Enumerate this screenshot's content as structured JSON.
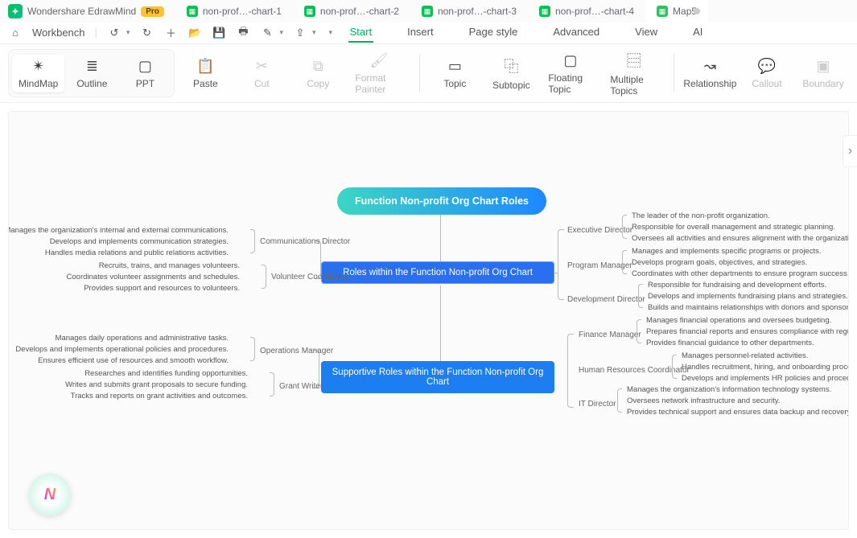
{
  "app": {
    "name": "Wondershare EdrawMind",
    "badge": "Pro",
    "logo_glyph": "✦"
  },
  "tabs": [
    {
      "label": "non-prof…-chart-1"
    },
    {
      "label": "non-prof…-chart-2"
    },
    {
      "label": "non-prof…-chart-3"
    },
    {
      "label": "non-prof…-chart-4"
    },
    {
      "label": "Map5",
      "active": true,
      "dirty": true
    }
  ],
  "toolbar": {
    "workbench": "Workbench"
  },
  "menu": {
    "start": "Start",
    "insert": "Insert",
    "page_style": "Page style",
    "advanced": "Advanced",
    "view": "View",
    "ai": "AI"
  },
  "ribbon": {
    "mindmap": "MindMap",
    "outline": "Outline",
    "ppt": "PPT",
    "paste": "Paste",
    "cut": "Cut",
    "copy": "Copy",
    "format_painter": "Format Painter",
    "topic": "Topic",
    "subtopic": "Subtopic",
    "floating": "Floating Topic",
    "multiple": "Multiple Topics",
    "relationship": "Relationship",
    "callout": "Callout",
    "boundary": "Boundary"
  },
  "mindmap": {
    "root": "Function Non-profit Org Chart Roles",
    "sec1": "Roles within the Function Non-profit Org Chart",
    "sec2": "Supportive Roles within the Function Non-profit Org Chart",
    "right1": {
      "exec": {
        "label": "Executive Director",
        "items": [
          "The leader of the non-profit organization.",
          "Responsible for overall management and strategic planning.",
          "Oversees all activities and ensures alignment with the organization's mission."
        ]
      },
      "prog": {
        "label": "Program Manager",
        "items": [
          "Manages and implements specific programs or projects.",
          "Develops program goals, objectives, and strategies.",
          "Coordinates with other departments to ensure program success."
        ]
      },
      "dev": {
        "label": "Development Director",
        "items": [
          "Responsible for fundraising and development efforts.",
          "Develops and implements fundraising plans and strategies.",
          "Builds and maintains relationships with donors and sponsors."
        ]
      }
    },
    "left1": {
      "comm": {
        "label": "Communications Director",
        "items": [
          "Manages the organization's internal and external communications.",
          "Develops and implements communication strategies.",
          "Handles media relations and public relations activities."
        ]
      },
      "vol": {
        "label": "Volunteer Coordinator",
        "items": [
          "Recruits, trains, and manages volunteers.",
          "Coordinates volunteer assignments and schedules.",
          "Provides support and resources to volunteers."
        ]
      }
    },
    "right2": {
      "fin": {
        "label": "Finance Manager",
        "items": [
          "Manages financial operations and oversees budgeting.",
          "Prepares financial reports and ensures compliance with regulations.",
          "Provides financial guidance to other departments."
        ]
      },
      "hr": {
        "label": "Human Resources Coordinator",
        "items": [
          "Manages personnel-related activities.",
          "Handles recruitment, hiring, and onboarding processes.",
          "Develops and implements HR policies and procedures."
        ]
      },
      "it": {
        "label": "IT Director",
        "items": [
          "Manages the organization's information technology systems.",
          "Oversees network infrastructure and security.",
          "Provides technical support and ensures data backup and recovery."
        ]
      }
    },
    "left2": {
      "ops": {
        "label": "Operations Manager",
        "items": [
          "Manages daily operations and administrative tasks.",
          "Develops and implements operational policies and procedures.",
          "Ensures efficient use of resources and smooth workflow."
        ]
      },
      "grant": {
        "label": "Grant Writer",
        "items": [
          "Researches and identifies funding opportunities.",
          "Writes and submits grant proposals to secure funding.",
          "Tracks and reports on grant activities and outcomes."
        ]
      }
    }
  },
  "fab": "N"
}
